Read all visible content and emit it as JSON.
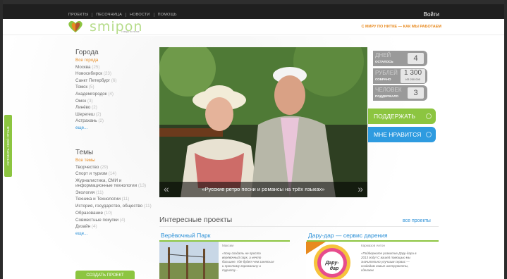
{
  "topbar": {
    "nav": [
      "ПРОЕКТЫ",
      "ПЕСОЧНИЦА",
      "НОВОСТИ",
      "ПОМОЩЬ"
    ],
    "login": "Войти"
  },
  "header": {
    "logo": "smipon",
    "logo_tag": "с миру по нитке",
    "tagline": "С МИРУ ПО НИТКЕ — КАК МЫ РАБОТАЕМ"
  },
  "side_tab": "ОСТАВИТЬ СВОЙ ОТЗЫВ",
  "cities": {
    "heading": "Города",
    "items": [
      {
        "name": "Все города",
        "count": ""
      },
      {
        "name": "Москва",
        "count": "(25)"
      },
      {
        "name": "Новосибирск",
        "count": "(23)"
      },
      {
        "name": "Санкт Петербург",
        "count": "(6)"
      },
      {
        "name": "Томск",
        "count": "(5)"
      },
      {
        "name": "Академгородок",
        "count": "(4)"
      },
      {
        "name": "Омск",
        "count": "(3)"
      },
      {
        "name": "Линёво",
        "count": "(2)"
      },
      {
        "name": "Шерегеш",
        "count": "(2)"
      },
      {
        "name": "Астрахань",
        "count": "(2)"
      }
    ],
    "more": "еще..."
  },
  "themes": {
    "heading": "Темы",
    "items": [
      {
        "name": "Все темы",
        "count": ""
      },
      {
        "name": "Творчество",
        "count": "(29)"
      },
      {
        "name": "Спорт и туризм",
        "count": "(14)"
      },
      {
        "name": "Журналистика, СМИ и информационные технологии",
        "count": "(13)"
      },
      {
        "name": "Экология",
        "count": "(11)"
      },
      {
        "name": "Техника и Технологии",
        "count": "(11)"
      },
      {
        "name": "История, государство, общество",
        "count": "(11)"
      },
      {
        "name": "Образование",
        "count": "(10)"
      },
      {
        "name": "Совместные покупки",
        "count": "(4)"
      },
      {
        "name": "Дизайн",
        "count": "(4)"
      }
    ],
    "more": "еще..."
  },
  "create_button": "СОЗДАТЬ ПРОЕКТ",
  "hero": {
    "caption": "«Русские ретро песни и романсы на трёх языках»"
  },
  "stats": {
    "days": {
      "label": "ДНЕЙ",
      "sub": "ОСТАЛОСЬ",
      "value": "4"
    },
    "rubles": {
      "label": "РУБЛЕЙ",
      "sub": "СОБРАНО",
      "value": "1 300",
      "goal": "ИЗ 200 000"
    },
    "people": {
      "label": "ЧЕЛОВЕК",
      "sub": "ПОДДЕРЖАЛО",
      "value": "3"
    }
  },
  "support_button": "ПОДДЕРЖАТЬ",
  "like_button": "МНЕ НРАВИТСЯ",
  "projects": {
    "heading": "Интересные проекты",
    "all": "все проекты",
    "items": [
      {
        "title": "Верёвочный Парк",
        "author": "Максим",
        "text": "«Хочу создать не просто верёвочный парк, а нечто большее. Где будет чем заняться и простому горожанину и туристу -"
      },
      {
        "title": "Дару-дар — сервис дарения",
        "author": "Кармазов Антон",
        "text": "«Поддержите развитие Дару-дара в 2013 году! С вашей помощью мы значительно улучшим сервис — создадим новые инструменты, сделаем"
      }
    ]
  },
  "colors": {
    "green": "#8cc540",
    "blue": "#2a8fd6",
    "orange": "#e88a1f",
    "grey": "#9a9a9a"
  }
}
